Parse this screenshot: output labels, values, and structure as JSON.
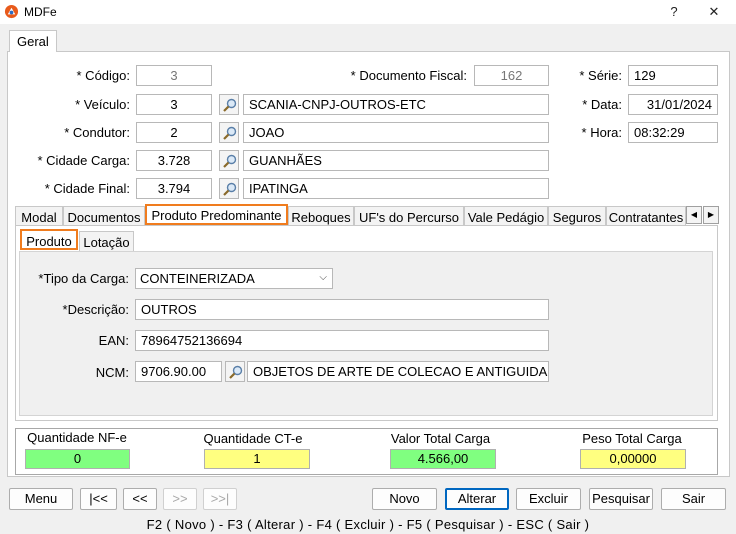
{
  "window": {
    "title": "MDFe",
    "help": "?",
    "close": "✕"
  },
  "main_tab": "Geral",
  "header": {
    "codigo": {
      "label": "* Código:",
      "value": "3"
    },
    "documento_fiscal": {
      "label": "* Documento Fiscal:",
      "value": "162"
    },
    "serie": {
      "label": "* Série:",
      "value": "129"
    },
    "veiculo": {
      "label": "* Veículo:",
      "code": "3",
      "name": "SCANIA-CNPJ-OUTROS-ETC"
    },
    "data": {
      "label": "* Data:",
      "value": "31/01/2024"
    },
    "condutor": {
      "label": "* Condutor:",
      "code": "2",
      "name": "JOAO"
    },
    "hora": {
      "label": "* Hora:",
      "value": "08:32:29"
    },
    "cidade_carga": {
      "label": "* Cidade Carga:",
      "code": "3.728",
      "name": "GUANHÃES"
    },
    "cidade_final": {
      "label": "* Cidade Final:",
      "code": "3.794",
      "name": "IPATINGA"
    }
  },
  "tabs": [
    "Modal",
    "Documentos",
    "Produto Predominante",
    "Reboques",
    "UF's do Percurso",
    "Vale Pedágio",
    "Seguros",
    "Contratantes"
  ],
  "subtabs": [
    "Produto",
    "Lotação"
  ],
  "produto": {
    "tipo_carga": {
      "label": "*Tipo da Carga:",
      "value": "CONTEINERIZADA"
    },
    "descricao": {
      "label": "*Descrição:",
      "value": "OUTROS"
    },
    "ean": {
      "label": "EAN:",
      "value": "78964752136694"
    },
    "ncm": {
      "label": "NCM:",
      "code": "9706.90.00",
      "description": "OBJETOS DE ARTE DE COLECAO E ANTIGUIDADES ..."
    }
  },
  "totals": {
    "qtd_nfe": {
      "label": "Quantidade NF-e",
      "value": "0",
      "color": "#80ff80"
    },
    "qtd_cte": {
      "label": "Quantidade CT-e",
      "value": "1",
      "color": "#ffff80"
    },
    "valor_total": {
      "label": "Valor Total Carga",
      "value": "4.566,00",
      "color": "#80ff80"
    },
    "peso_total": {
      "label": "Peso Total Carga",
      "value": "0,00000",
      "color": "#ffff80"
    }
  },
  "buttons": {
    "menu": "Menu",
    "first": "|<<",
    "prev": "<<",
    "next": ">>",
    "last": ">>|",
    "novo": "Novo",
    "alterar": "Alterar",
    "excluir": "Excluir",
    "pesquisar": "Pesquisar",
    "sair": "Sair"
  },
  "status_bar": "F2 ( Novo )  -  F3 ( Alterar )  -  F4 ( Excluir )  -  F5 ( Pesquisar )  -  ESC ( Sair )",
  "icons": {
    "app": "mdfe-logo-icon",
    "search": "magnifier-icon",
    "dropdown": "chevron-down-icon"
  }
}
